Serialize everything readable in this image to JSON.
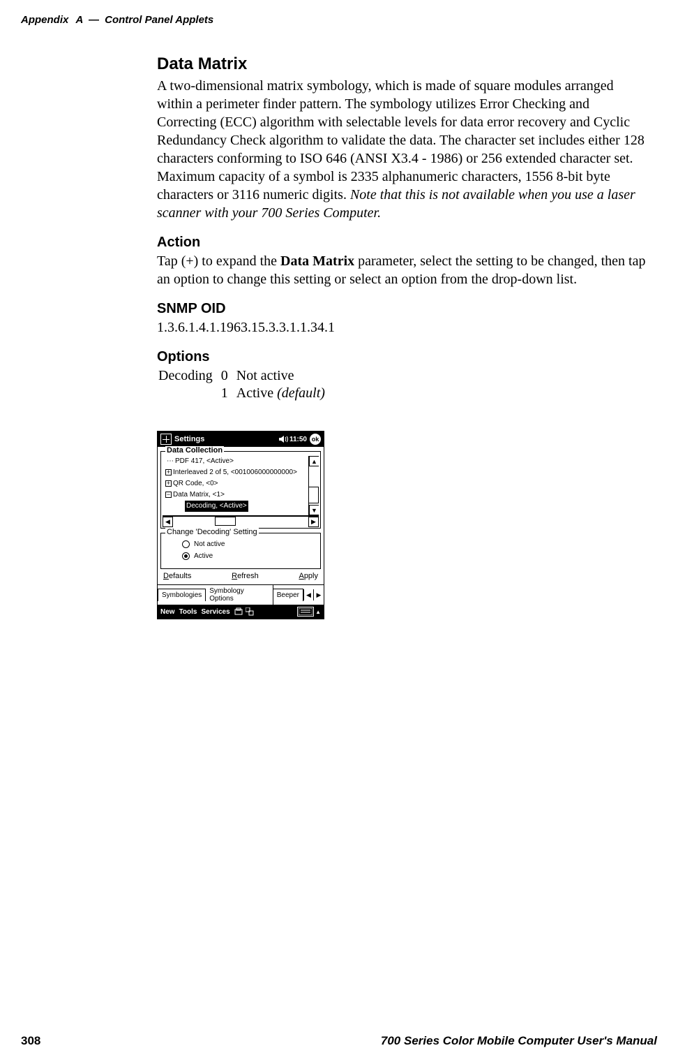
{
  "header": {
    "appendix": "Appendix",
    "appendix_letter": "A",
    "dash": "—",
    "section": "Control Panel Applets"
  },
  "section": {
    "title": "Data Matrix",
    "body_1": "A two-dimensional matrix symbology, which is made of square modules arranged within a perimeter finder pattern. The symbology utilizes Error Checking and Correcting (ECC) algorithm with selectable levels for data error recovery and Cyclic Redundancy Check algorithm to validate the data. The character set includes either 128 characters conforming to ISO 646 (ANSI X3.4 - 1986) or 256 extended character set. Maximum capacity of a symbol is 2335 alphanumeric characters, 1556 8-bit byte characters or 3116 numeric digits. ",
    "body_1_ital": "Note that this is not available when you use a laser scanner with your 700 Series Computer.",
    "action_head": "Action",
    "action_body_pre": "Tap (+) to expand the ",
    "action_body_bold": "Data Matrix",
    "action_body_post": " parameter, select the setting to be changed, then tap an option to change this setting or select an option from the drop-down list.",
    "snmp_head": "SNMP OID",
    "snmp_value": "1.3.6.1.4.1.1963.15.3.3.1.1.34.1",
    "options_head": "Options",
    "options": {
      "param": "Decoding",
      "rows": [
        {
          "value": "0",
          "label": "Not active"
        },
        {
          "value": "1",
          "label_pre": "Active ",
          "label_ital": "(default)"
        }
      ]
    }
  },
  "screenshot": {
    "titlebar": {
      "app": "Settings",
      "time": "11:50",
      "ok": "ok"
    },
    "group_title": "Data Collection",
    "tree": [
      {
        "glyph": "⋯",
        "label": "PDF 417, <Active>"
      },
      {
        "glyph": "+",
        "label": "Interleaved 2 of 5, <001006000000000>"
      },
      {
        "glyph": "+",
        "label": "QR Code, <0>"
      },
      {
        "glyph": "−",
        "label": "Data Matrix, <1>"
      },
      {
        "child": true,
        "label": "Decoding, <Active>",
        "selected": true
      }
    ],
    "setting": {
      "legend": "Change 'Decoding' Setting",
      "radios": [
        {
          "label": "Not active",
          "checked": false
        },
        {
          "label": "Active",
          "checked": true
        }
      ]
    },
    "buttons": {
      "defaults": "Defaults",
      "refresh": "Refresh",
      "apply": "Apply"
    },
    "tabs": [
      "Symbologies",
      "Symbology Options",
      "Beeper"
    ],
    "bottombar": {
      "menus": [
        "New",
        "Tools",
        "Services"
      ]
    }
  },
  "footer": {
    "page": "308",
    "doc": "700 Series Color Mobile Computer User's Manual"
  }
}
